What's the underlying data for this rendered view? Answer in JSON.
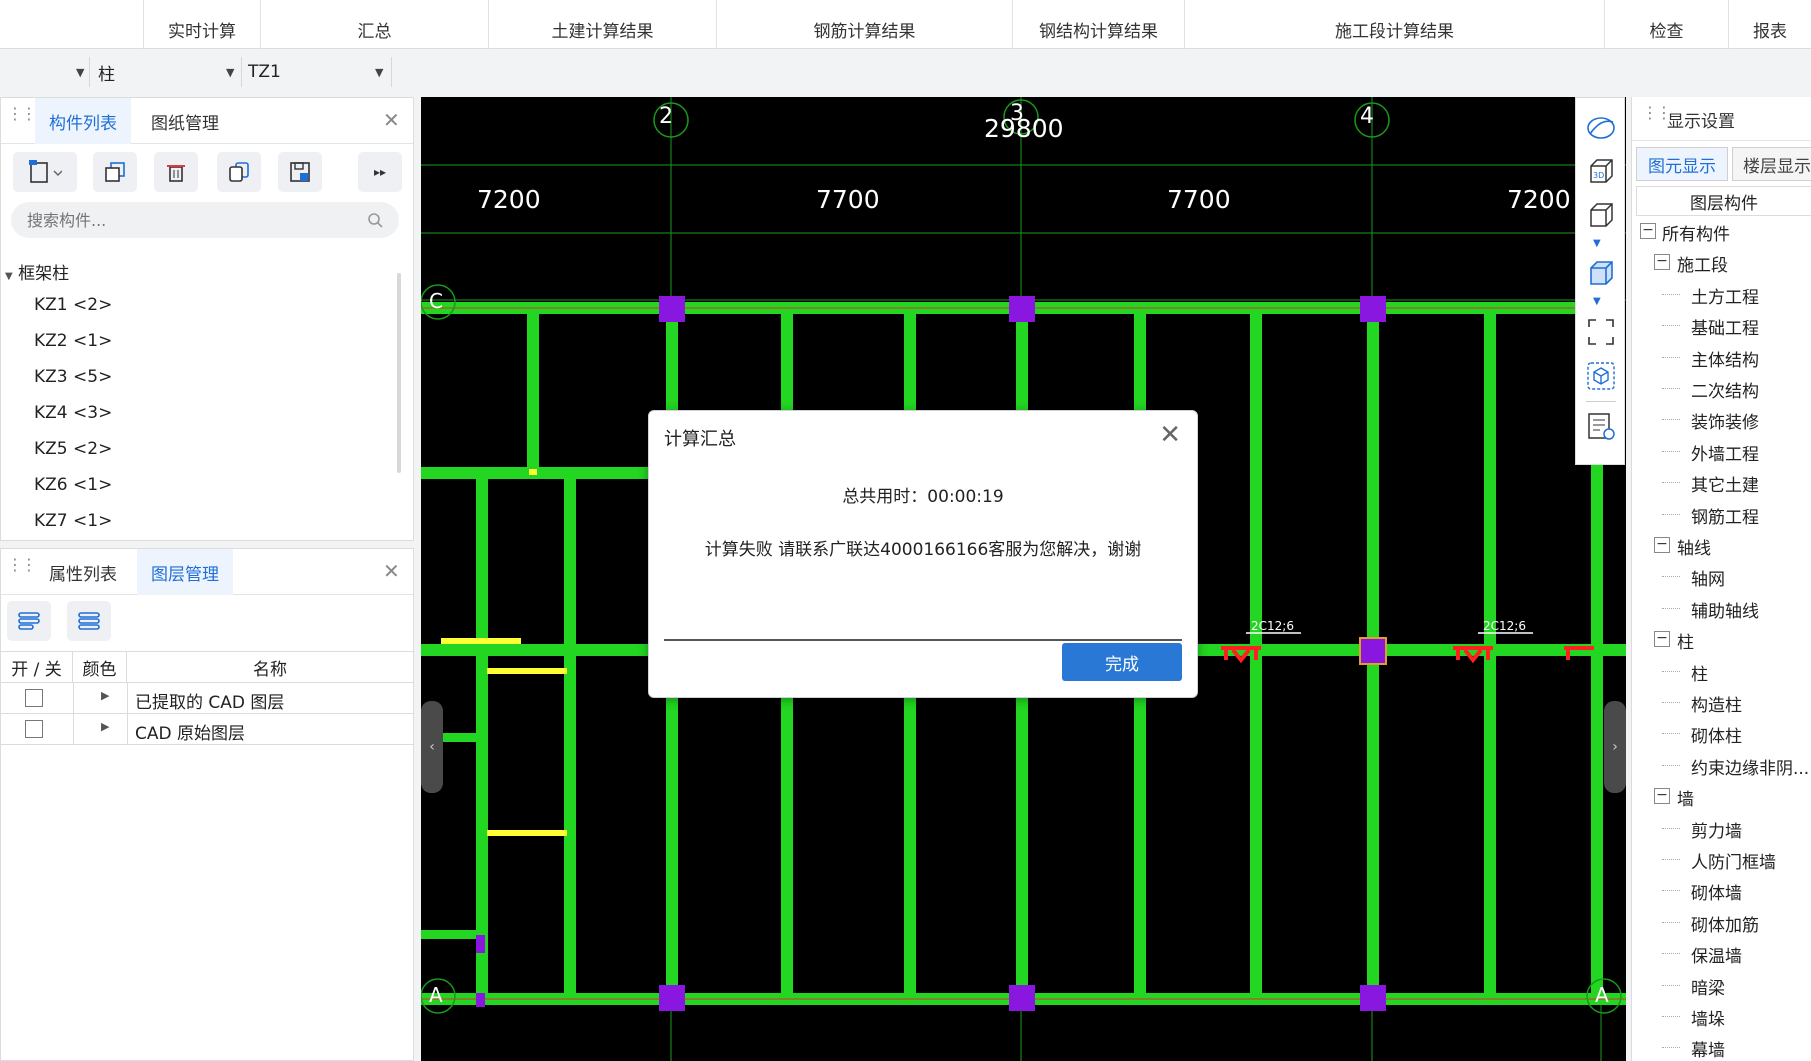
{
  "ribbon": {
    "tabs": [
      "实时计算",
      "汇总",
      "土建计算结果",
      "钢筋计算结果",
      "钢结构计算结果",
      "施工段计算结果",
      "检查",
      "报表"
    ]
  },
  "selectors": {
    "type": "柱",
    "component": "TZ1"
  },
  "component_panel": {
    "tabs": [
      "构件列表",
      "图纸管理"
    ],
    "search_placeholder": "搜索构件...",
    "group": "框架柱",
    "items": [
      "KZ1 <2>",
      "KZ2 <1>",
      "KZ3 <5>",
      "KZ4 <3>",
      "KZ5 <2>",
      "KZ6 <1>",
      "KZ7 <1>"
    ]
  },
  "layer_panel": {
    "tabs": [
      "属性列表",
      "图层管理"
    ],
    "columns": [
      "开 / 关",
      "颜色",
      "名称"
    ],
    "rows": [
      {
        "name": "已提取的 CAD 图层"
      },
      {
        "name": "CAD 原始图层"
      }
    ]
  },
  "canvas": {
    "axis_top": [
      "2",
      "3",
      "4"
    ],
    "axis_left": [
      "C",
      "A"
    ],
    "total_dim": "29800",
    "spans": [
      "7200",
      "7700",
      "7700",
      "7200"
    ],
    "rebar_label": "2C12;6"
  },
  "display_settings": {
    "title": "显示设置",
    "tabs": [
      "图元显示",
      "楼层显示"
    ],
    "header": "图层构件",
    "tree": [
      {
        "label": "所有构件",
        "level": 0,
        "box": true
      },
      {
        "label": "施工段",
        "level": 1,
        "box": true
      },
      {
        "label": "土方工程",
        "level": 2
      },
      {
        "label": "基础工程",
        "level": 2
      },
      {
        "label": "主体结构",
        "level": 2
      },
      {
        "label": "二次结构",
        "level": 2
      },
      {
        "label": "装饰装修",
        "level": 2
      },
      {
        "label": "外墙工程",
        "level": 2
      },
      {
        "label": "其它土建",
        "level": 2
      },
      {
        "label": "钢筋工程",
        "level": 2
      },
      {
        "label": "轴线",
        "level": 1,
        "box": true
      },
      {
        "label": "轴网",
        "level": 2
      },
      {
        "label": "辅助轴线",
        "level": 2
      },
      {
        "label": "柱",
        "level": 1,
        "box": true
      },
      {
        "label": "柱",
        "level": 2
      },
      {
        "label": "构造柱",
        "level": 2
      },
      {
        "label": "砌体柱",
        "level": 2
      },
      {
        "label": "约束边缘非阴...",
        "level": 2
      },
      {
        "label": "墙",
        "level": 1,
        "box": true
      },
      {
        "label": "剪力墙",
        "level": 2
      },
      {
        "label": "人防门框墙",
        "level": 2
      },
      {
        "label": "砌体墙",
        "level": 2
      },
      {
        "label": "砌体加筋",
        "level": 2
      },
      {
        "label": "保温墙",
        "level": 2
      },
      {
        "label": "暗梁",
        "level": 2
      },
      {
        "label": "墙垛",
        "level": 2
      },
      {
        "label": "幕墙",
        "level": 2
      }
    ]
  },
  "dialog": {
    "title": "计算汇总",
    "time_text": "总共用时：00:00:19",
    "message": "计算失败 请联系广联达4000166166客服为您解决，谢谢",
    "ok_label": "完成"
  }
}
